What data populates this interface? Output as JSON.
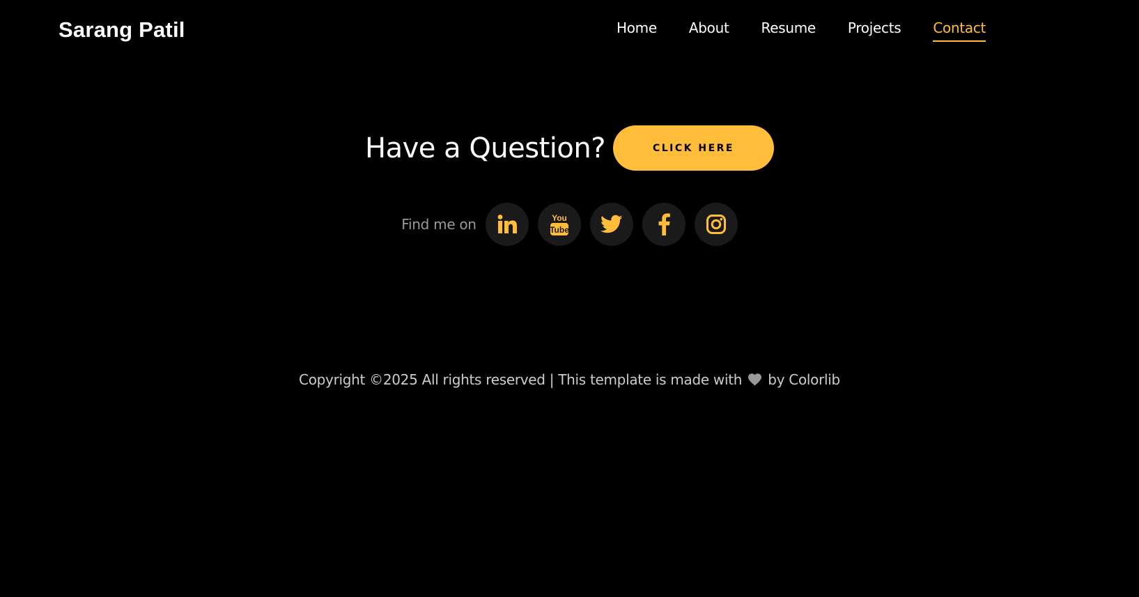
{
  "brand": {
    "name": "Sarang Patil"
  },
  "nav": {
    "items": [
      {
        "label": "Home"
      },
      {
        "label": "About"
      },
      {
        "label": "Resume"
      },
      {
        "label": "Projects"
      },
      {
        "label": "Contact",
        "active": true
      }
    ]
  },
  "contact": {
    "question": "Have a Question?",
    "cta_label": "CLICK HERE",
    "find_label": "Find me on",
    "socials": [
      {
        "icon": "linkedin-icon"
      },
      {
        "icon": "youtube-icon"
      },
      {
        "icon": "twitter-icon"
      },
      {
        "icon": "facebook-icon"
      },
      {
        "icon": "instagram-icon"
      }
    ]
  },
  "footer": {
    "text_before": "Copyright ©2025 All rights reserved | This template is made with",
    "text_by": "by",
    "credit_link": "Colorlib"
  },
  "colors": {
    "background": "#000000",
    "accent": "#ffbd39",
    "social_bg": "#1a1a1a",
    "muted_text": "#999999",
    "footer_text": "#cccccc"
  }
}
